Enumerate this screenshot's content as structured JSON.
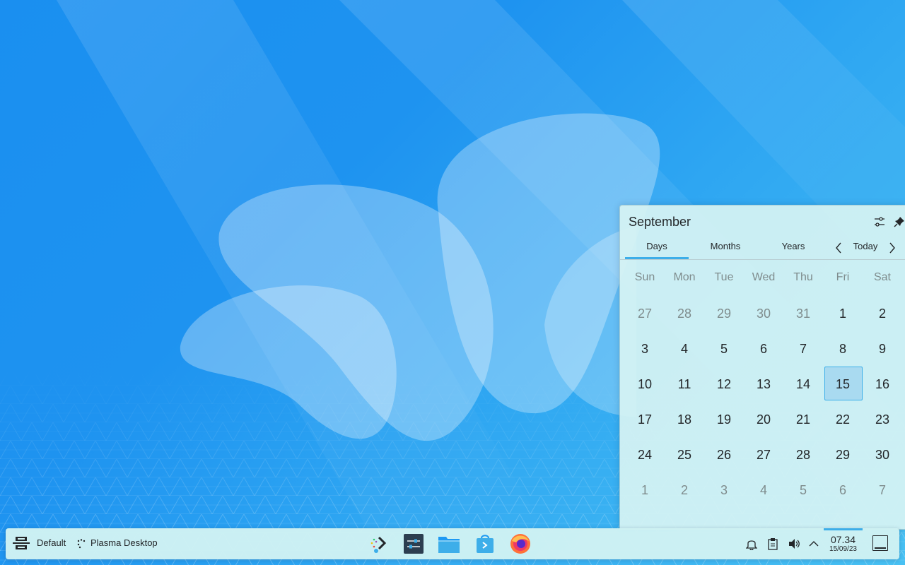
{
  "calendar": {
    "title": "September",
    "tabs": [
      {
        "label": "Days",
        "active": true
      },
      {
        "label": "Months",
        "active": false
      },
      {
        "label": "Years",
        "active": false
      }
    ],
    "today_label": "Today",
    "weekdays": [
      "Sun",
      "Mon",
      "Tue",
      "Wed",
      "Thu",
      "Fri",
      "Sat"
    ],
    "weeks": [
      [
        {
          "d": "27",
          "other": true
        },
        {
          "d": "28",
          "other": true
        },
        {
          "d": "29",
          "other": true
        },
        {
          "d": "30",
          "other": true
        },
        {
          "d": "31",
          "other": true
        },
        {
          "d": "1"
        },
        {
          "d": "2"
        }
      ],
      [
        {
          "d": "3"
        },
        {
          "d": "4"
        },
        {
          "d": "5"
        },
        {
          "d": "6"
        },
        {
          "d": "7"
        },
        {
          "d": "8"
        },
        {
          "d": "9"
        }
      ],
      [
        {
          "d": "10"
        },
        {
          "d": "11"
        },
        {
          "d": "12"
        },
        {
          "d": "13"
        },
        {
          "d": "14"
        },
        {
          "d": "15",
          "today": true
        },
        {
          "d": "16"
        }
      ],
      [
        {
          "d": "17"
        },
        {
          "d": "18"
        },
        {
          "d": "19"
        },
        {
          "d": "20"
        },
        {
          "d": "21"
        },
        {
          "d": "22"
        },
        {
          "d": "23"
        }
      ],
      [
        {
          "d": "24"
        },
        {
          "d": "25"
        },
        {
          "d": "26"
        },
        {
          "d": "27"
        },
        {
          "d": "28"
        },
        {
          "d": "29"
        },
        {
          "d": "30"
        }
      ],
      [
        {
          "d": "1",
          "other": true
        },
        {
          "d": "2",
          "other": true
        },
        {
          "d": "3",
          "other": true
        },
        {
          "d": "4",
          "other": true
        },
        {
          "d": "5",
          "other": true
        },
        {
          "d": "6",
          "other": true
        },
        {
          "d": "7",
          "other": true
        }
      ]
    ],
    "icons": {
      "configure": "settings-sliders-icon",
      "pin": "pin-icon",
      "prev": "chevron-left-icon",
      "next": "chevron-right-icon"
    }
  },
  "taskbar": {
    "activity_label": "Default",
    "desktop_label": "Plasma Desktop",
    "launchers": [
      "kde-launcher-icon",
      "system-settings-icon",
      "file-manager-icon",
      "discover-store-icon",
      "firefox-icon"
    ],
    "tray": [
      "notifications-icon",
      "clipboard-icon",
      "volume-icon",
      "expand-tray-icon"
    ],
    "clock_time": "07.34",
    "clock_date": "15/09/23"
  },
  "colors": {
    "accent": "#3daee9",
    "text": "#232629",
    "muted": "#7f8c8d",
    "today_bg": "#a9daf0"
  }
}
